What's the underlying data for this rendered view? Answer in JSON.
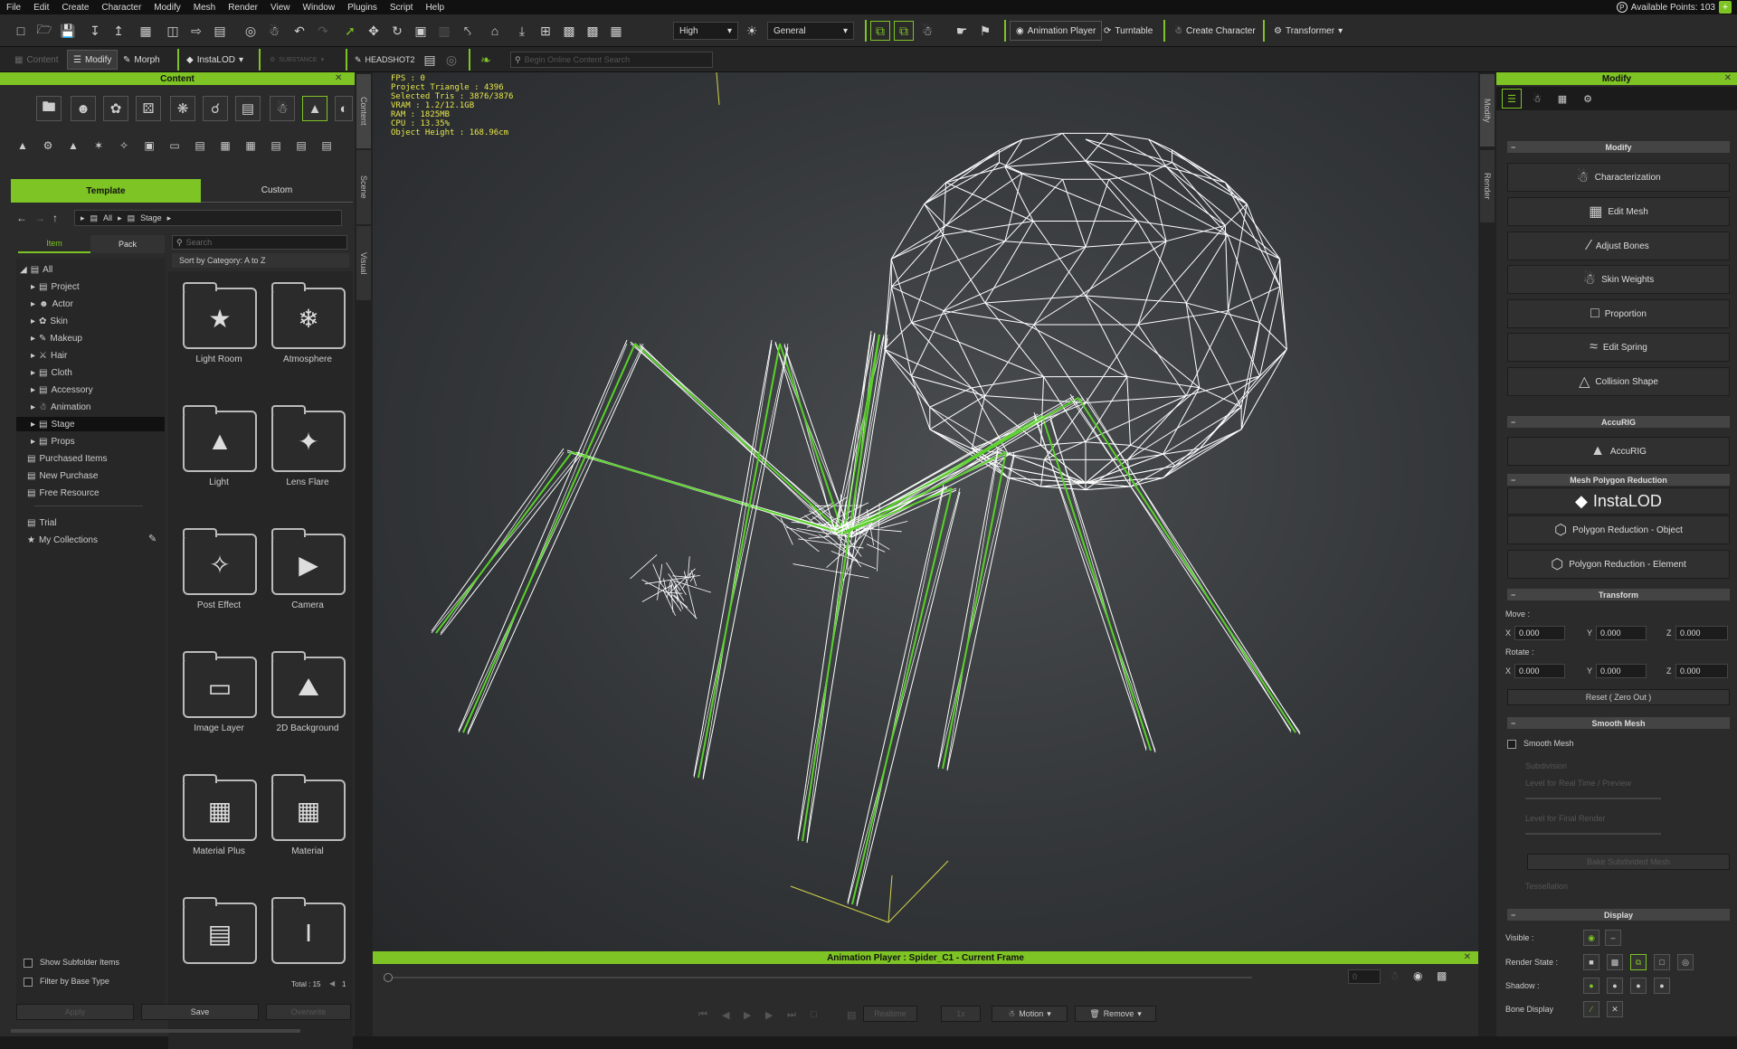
{
  "menu": [
    "File",
    "Edit",
    "Create",
    "Character",
    "Modify",
    "Mesh",
    "Render",
    "View",
    "Window",
    "Plugins",
    "Script",
    "Help"
  ],
  "points": "Available Points: 103",
  "toolbar": {
    "quality": "High",
    "mode": "General",
    "animation_player": "Animation Player",
    "turntable": "Turntable",
    "create_character": "Create Character",
    "transformer": "Transformer"
  },
  "toolbar2": {
    "content": "Content",
    "modify": "Modify",
    "morph": "Morph",
    "instalod": "InstaLOD",
    "substance": "SUBSTANCE",
    "headshot": "HEADSHOT2",
    "search_placeholder": "Begin Online Content Search"
  },
  "content": {
    "title": "Content",
    "tabs": [
      "Template",
      "Custom"
    ],
    "breadcrumb": [
      "All",
      "Stage"
    ],
    "subtabs": [
      "Item",
      "Pack"
    ],
    "search_placeholder": "Search",
    "sort": "Sort by Category: A to Z",
    "tree": [
      "All",
      "Project",
      "Actor",
      "Skin",
      "Makeup",
      "Hair",
      "Cloth",
      "Accessory",
      "Animation",
      "Stage",
      "Props",
      "Purchased Items",
      "New Purchase",
      "Free Resource",
      "Trial",
      "My Collections"
    ],
    "items": [
      "Light Room",
      "Atmosphere",
      "Light",
      "Lens Flare",
      "Post Effect",
      "Camera",
      "Image Layer",
      "2D Background",
      "Material Plus",
      "Material"
    ],
    "show_subfolder": "Show Subfolder Items",
    "filter_base": "Filter by Base Type",
    "total": "Total : 15",
    "page": "1",
    "btn_apply": "Apply",
    "btn_save": "Save",
    "btn_overwrite": "Overwrite"
  },
  "side_tabs_left": [
    "Content",
    "Scene",
    "Visual"
  ],
  "side_tabs_right": [
    "Modify",
    "Render"
  ],
  "stats": "FPS : 0\nProject Triangle : 4396\nSelected Tris : 3876/3876\nVRAM : 1.2/12.1GB\nRAM : 1825MB\nCPU : 13.35%\nObject Height : 168.96cm",
  "anim": {
    "title": "Animation Player : Spider_C1 - Current Frame",
    "frame": "0",
    "realtime": "Realtime",
    "speed": "1x",
    "motion": "Motion",
    "remove": "Remove"
  },
  "modify": {
    "title": "Modify",
    "section_modify": "Modify",
    "buttons": [
      "Characterization",
      "Edit Mesh",
      "Adjust Bones",
      "Skin Weights",
      "Proportion",
      "Edit Spring",
      "Collision Shape"
    ],
    "section_accurig": "AccuRIG",
    "accurig": "AccuRIG",
    "section_reduction": "Mesh Polygon Reduction",
    "instalod": "InstaLOD",
    "poly_object": "Polygon Reduction - Object",
    "poly_element": "Polygon Reduction - Element",
    "section_transform": "Transform",
    "move": "Move :",
    "rotate": "Rotate :",
    "axes": [
      "X",
      "Y",
      "Z"
    ],
    "move_vals": [
      "0.000",
      "0.000",
      "0.000"
    ],
    "rotate_vals": [
      "0.000",
      "0.000",
      "0.000"
    ],
    "reset": "Reset ( Zero Out )",
    "section_smooth": "Smooth Mesh",
    "smooth_mesh": "Smooth Mesh",
    "subdivision": "Subdivision",
    "level_rt": "Level for Real Time / Preview",
    "level_final": "Level for Final Render",
    "bake": "Bake Subdivided Mesh",
    "tessellation": "Tessellation",
    "section_display": "Display",
    "visible": "Visible :",
    "render_state": "Render State :",
    "shadow": "Shadow :",
    "bone_display": "Bone Display"
  },
  "colors": {
    "accent": "#7ec424",
    "stats": "#e8e84a",
    "wire": "#ffffff",
    "bone": "#59d12a"
  }
}
